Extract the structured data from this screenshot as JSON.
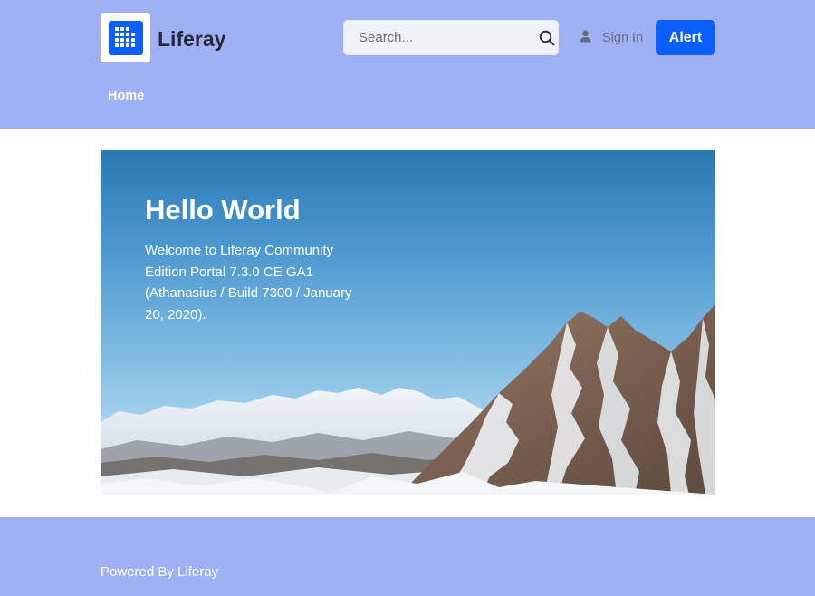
{
  "header": {
    "site_name": "Liferay",
    "logo_icon": "liferay-logo-icon",
    "search": {
      "placeholder": "Search...",
      "icon": "search-icon"
    },
    "sign_in": {
      "label": "Sign In",
      "icon": "user-icon"
    },
    "alert_button": {
      "label": "Alert"
    },
    "nav": {
      "items": [
        {
          "label": "Home"
        }
      ]
    }
  },
  "hero": {
    "title": "Hello World",
    "body": "Welcome to Liferay Community Edition Portal 7.3.0 CE GA1 (Athanasius / Build 7300 / January 20, 2020)."
  },
  "footer": {
    "text": "Powered By Liferay"
  },
  "colors": {
    "header_bg": "#9fb0f4",
    "footer_bg": "#9fb0f4",
    "primary": "#0b5fff",
    "text_dark": "#272833",
    "text_muted": "#6b6c7e"
  }
}
